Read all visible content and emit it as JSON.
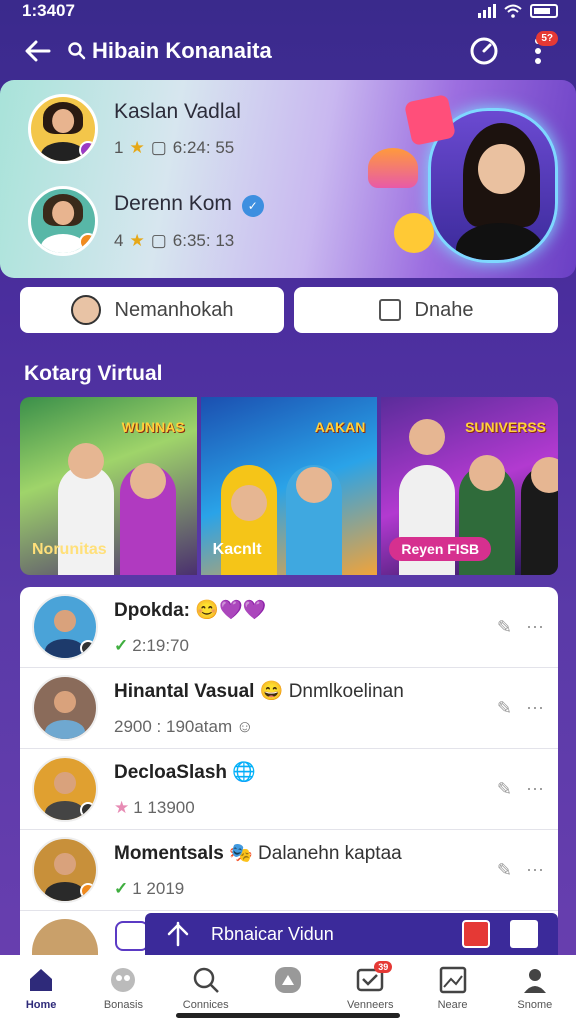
{
  "status_bar": {
    "time": "1:3407"
  },
  "header": {
    "title": "Hibain Konanaita",
    "notification_count": "5?"
  },
  "hero": {
    "users": [
      {
        "name": "Kaslan Vadlal",
        "rating": "1",
        "stat": "6:24: 55"
      },
      {
        "name": "Derenn Kom",
        "rating": "4",
        "stat": "6:35: 13"
      }
    ]
  },
  "actions": {
    "left_label": "Nemanhokah",
    "right_label": "Dnahe"
  },
  "section": {
    "title": "Kotarg Virtual"
  },
  "cards": [
    {
      "label": "Norunitas",
      "sign": "WUNNAS"
    },
    {
      "label": "Kacnlt",
      "sign": "AAKAN"
    },
    {
      "label": "Reyen FISB",
      "sign": "SUNIVERSS"
    }
  ],
  "list": [
    {
      "title": "Dpokda:",
      "subtitle": "",
      "meta": "2:19:70",
      "emoji": "😊💜💜"
    },
    {
      "title": "Hinantal Vasual",
      "subtitle": "Dnmlkoelinan",
      "meta": "2900 : 190atam",
      "emoji": "😄"
    },
    {
      "title": "DecloaSlash",
      "subtitle": "",
      "meta": "1 13900",
      "emoji": "🌐"
    },
    {
      "title": "Momentsals",
      "subtitle": "Dalanehn kaptaa",
      "meta": "1 2019",
      "emoji": "🎭"
    }
  ],
  "player": {
    "title": "Rbnaicar Vidun"
  },
  "nav": [
    {
      "label": "Home",
      "icon": "home-icon",
      "active": true
    },
    {
      "label": "Bonasis",
      "icon": "people-icon"
    },
    {
      "label": "Connices",
      "icon": "search-icon"
    },
    {
      "label": "",
      "icon": "create-icon"
    },
    {
      "label": "Venneers",
      "icon": "inbox-icon",
      "badge": "39"
    },
    {
      "label": "Neare",
      "icon": "gallery-icon"
    },
    {
      "label": "Snome",
      "icon": "profile-icon"
    }
  ]
}
